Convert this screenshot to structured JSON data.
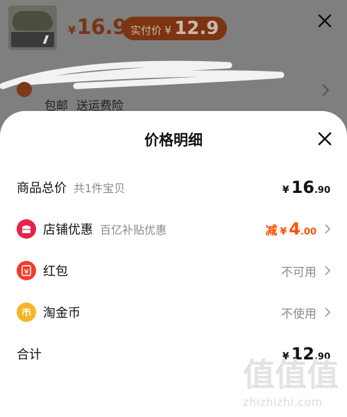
{
  "background": {
    "price_currency": "¥",
    "price_value": "16.9",
    "badge_label": "实付价",
    "badge_currency": "¥",
    "badge_value": "12.9",
    "shipping": [
      "包邮",
      "送运费险"
    ]
  },
  "sheet": {
    "title": "价格明细"
  },
  "rows": {
    "total_goods": {
      "label": "商品总价",
      "sub": "共1件宝贝",
      "currency": "¥",
      "int": "16",
      "dec": ".90"
    },
    "shop_discount": {
      "label": "店铺优惠",
      "sub": "百亿补贴优惠",
      "prefix": "减",
      "currency": "¥",
      "int": "4",
      "dec": ".00"
    },
    "red_packet": {
      "label": "红包",
      "status": "不可用"
    },
    "taojin_coin": {
      "label": "淘金币",
      "status": "不使用"
    },
    "sum": {
      "label": "合计",
      "currency": "¥",
      "int": "12",
      "dec": ".90"
    }
  },
  "watermark": {
    "chars": [
      "值",
      "值",
      "值"
    ],
    "url": "zhizhizhi.com"
  },
  "colors": {
    "accent": "#ff5000",
    "discount_icon": "#e8224a",
    "red_packet_icon": "#f03c2d",
    "coin_icon": "#f5b52a",
    "muted": "#8a8a8a"
  }
}
